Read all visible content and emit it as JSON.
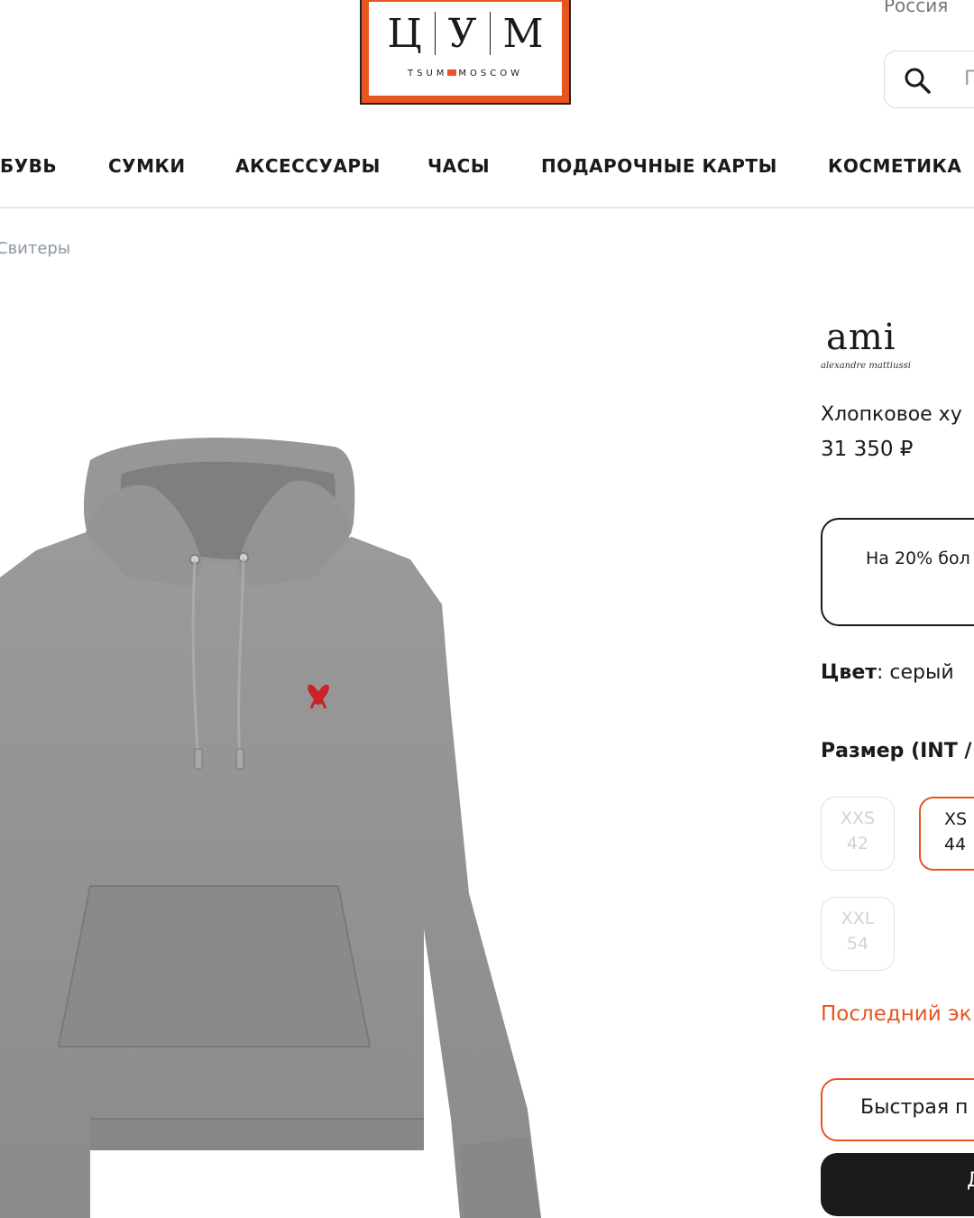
{
  "header": {
    "logo": {
      "letters": [
        "Ц",
        "У",
        "М"
      ],
      "sub_left": "TSUM",
      "sub_right": "MOSCOW"
    },
    "region": "Россия",
    "search_placeholder": "П"
  },
  "nav": {
    "items": [
      "БУВЬ",
      "СУМКИ",
      "АКСЕССУАРЫ",
      "ЧАСЫ",
      "ПОДАРОЧНЫЕ КАРТЫ",
      "КОСМЕТИКА"
    ]
  },
  "breadcrumb": "Свитеры",
  "product": {
    "brand": "ami",
    "brand_sub": "alexandre mattiussi",
    "title": "Хлопковое ху",
    "price": "31 350 ₽",
    "promo": "На 20% бол",
    "color_label": "Цвет",
    "color_value": "серый",
    "size_label": "Размер (INT /",
    "sizes": [
      {
        "int": "XXS",
        "ru": "42",
        "state": "disabled"
      },
      {
        "int": "XS",
        "ru": "44",
        "state": "selected"
      },
      {
        "int": "XXL",
        "ru": "54",
        "state": "disabled"
      }
    ],
    "stock_note": "Последний эк",
    "quick_buy": "Быстрая п",
    "add_to_cart": "Д"
  },
  "colors": {
    "accent": "#e8551f",
    "dark": "#1a1a1a",
    "muted": "#8c96a3",
    "hoodie": "#8f8f8f"
  },
  "icons": {
    "search": "search-icon",
    "brand_logo": "ami-heart-logo"
  }
}
